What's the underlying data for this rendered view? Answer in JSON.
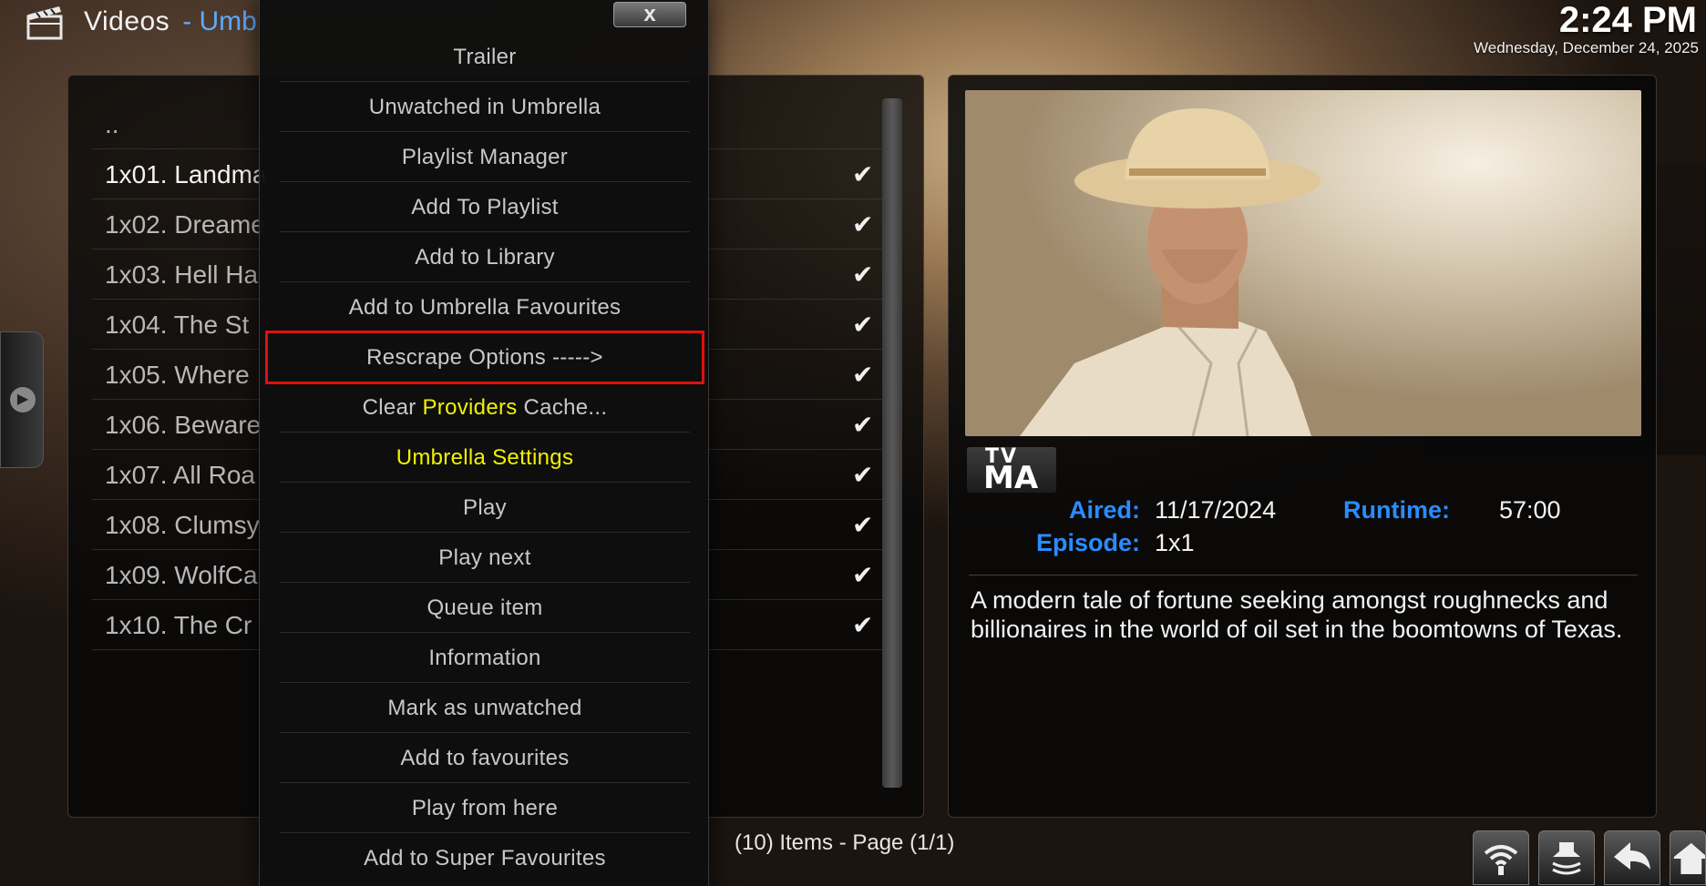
{
  "header": {
    "title": "Videos",
    "subtitle": "- Umb"
  },
  "clock": {
    "time": "2:24 PM",
    "date": "Wednesday, December 24, 2025"
  },
  "list": {
    "items": [
      {
        "label": "..",
        "checked": false
      },
      {
        "label": "1x01. Landma",
        "checked": true
      },
      {
        "label": "1x02. Dreame",
        "checked": true
      },
      {
        "label": "1x03. Hell Ha",
        "checked": true
      },
      {
        "label": "1x04. The St",
        "checked": true
      },
      {
        "label": "1x05. Where",
        "checked": true
      },
      {
        "label": "1x06. Beware",
        "checked": true
      },
      {
        "label": "1x07. All Roa",
        "checked": true
      },
      {
        "label": "1x08. Clumsy",
        "checked": true
      },
      {
        "label": "1x09. WolfCa",
        "checked": true
      },
      {
        "label": "1x10. The Cr",
        "checked": true
      }
    ],
    "check_glyph": "✔"
  },
  "context_menu": {
    "close_label": "x",
    "items": [
      {
        "label": "Trailer"
      },
      {
        "label": "Unwatched in Umbrella"
      },
      {
        "label": "Playlist Manager"
      },
      {
        "label": "Add To Playlist"
      },
      {
        "label": "Add to Library"
      },
      {
        "label": "Add to Umbrella Favourites"
      },
      {
        "label": "Rescrape Options ----->",
        "selected": true
      },
      {
        "label_before": "Clear ",
        "label_highlight": "Providers",
        "label_after": " Cache..."
      },
      {
        "label": "Umbrella Settings",
        "yellow": true
      },
      {
        "label": "Play"
      },
      {
        "label": "Play next"
      },
      {
        "label": "Queue item"
      },
      {
        "label": "Information"
      },
      {
        "label": "Mark as unwatched"
      },
      {
        "label": "Add to favourites"
      },
      {
        "label": "Play from here"
      },
      {
        "label": "Add to Super Favourites"
      }
    ]
  },
  "info": {
    "rating_top": "TV",
    "rating_main": "MA",
    "aired_label": "Aired:",
    "aired_value": "11/17/2024",
    "runtime_label": "Runtime:",
    "runtime_value": "57:00",
    "episode_label": "Episode:",
    "episode_value": "1x1",
    "plot": "A modern tale of fortune seeking amongst roughnecks and billionaires in the world of oil set in the boomtowns of Texas."
  },
  "footer": {
    "items_count": "(10) Items - Page (1/1)"
  },
  "colors": {
    "accent_blue": "#2a8cff",
    "highlight_yellow": "#f2f200",
    "selection_red": "#e01010"
  }
}
